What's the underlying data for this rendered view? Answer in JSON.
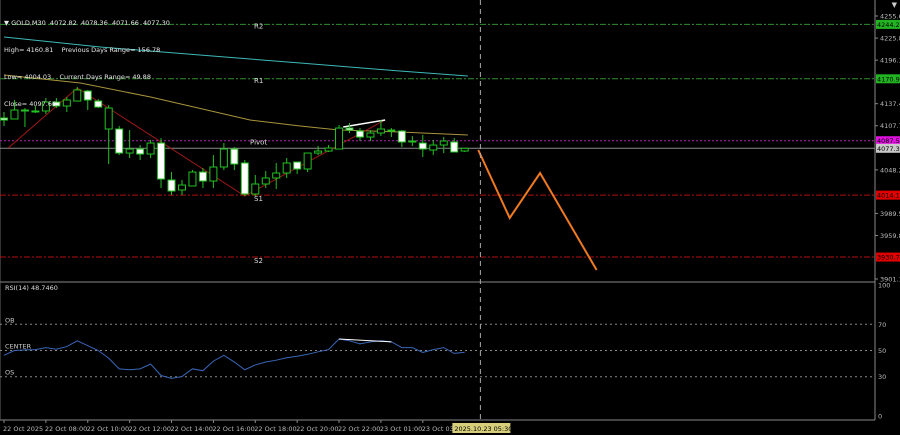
{
  "header": {
    "symbol_line": "GOLD,M30  4072.82  4078.36  4071.66  4077.30",
    "high": "High= 4160.81",
    "prev_range": "Previous Days Range= 156.78",
    "low": "Low= 4004.03",
    "curr_range": "Current Days Range= 49.88",
    "close": "Close= 4097.66"
  },
  "colors": {
    "background": "#000000",
    "candle_outline": "#22c322",
    "bear_fill": "#ffffff",
    "resistance": "#2f8f2f",
    "pivot": "#b020b0",
    "support": "#b01010",
    "ma_slow": "#3fb8b8",
    "ma_fast": "#a8943c",
    "zigzag": "#a01818",
    "forecast": "#f07a20",
    "rsi": "#3a66b8",
    "crosshair_label": "#d8cf7a"
  },
  "chart_data": [
    {
      "type": "candlestick",
      "title": "GOLD,M30",
      "ylim": [
        3901.15,
        4255.6
      ],
      "price_ticks": [
        "4255.60",
        "4225.85",
        "4196.10",
        "4137.45",
        "4107.70",
        "4048.20",
        "3989.55",
        "3959.80",
        "3901.15"
      ],
      "x_tick_labels": [
        "22 Oct 2025",
        "22 Oct 08:00",
        "22 Oct 10:00",
        "22 Oct 12:00",
        "22 Oct 14:00",
        "22 Oct 16:00",
        "22 Oct 18:00",
        "22 Oct 20:00",
        "22 Oct 22:00",
        "23 Oct 01:00",
        "23 Oct 03"
      ],
      "x_tick_bars": [
        0,
        4,
        8,
        12,
        16,
        20,
        24,
        28,
        32,
        36,
        40
      ],
      "candles_ohlc": [
        [
          4118.1,
          4126.2,
          4107.3,
          4115.4
        ],
        [
          4116.8,
          4142.4,
          4116.8,
          4128.9
        ],
        [
          4128.9,
          4131.6,
          4106.0,
          4128.0
        ],
        [
          4127.6,
          4134.3,
          4124.9,
          4127.0
        ],
        [
          4127.6,
          4145.1,
          4123.5,
          4139.7
        ],
        [
          4139.7,
          4145.1,
          4131.6,
          4134.3
        ],
        [
          4134.3,
          4146.4,
          4126.2,
          4142.4
        ],
        [
          4141.0,
          4159.9,
          4141.0,
          4155.9
        ],
        [
          4154.5,
          4155.9,
          4128.9,
          4142.4
        ],
        [
          4141.0,
          4143.7,
          4131.6,
          4132.9
        ],
        [
          4103.3,
          4135.6,
          4056.1,
          4131.6
        ],
        [
          4103.3,
          4107.3,
          4068.2,
          4070.9
        ],
        [
          4070.9,
          4101.9,
          4064.2,
          4076.3
        ],
        [
          4076.3,
          4081.7,
          4061.5,
          4069.6
        ],
        [
          4069.6,
          4088.5,
          4064.2,
          4084.4
        ],
        [
          4084.4,
          4091.2,
          4023.8,
          4035.9
        ],
        [
          4034.6,
          4045.3,
          4014.3,
          4019.7
        ],
        [
          4021.1,
          4034.6,
          4014.3,
          4027.8
        ],
        [
          4026.5,
          4048.0,
          4026.5,
          4045.3
        ],
        [
          4045.3,
          4050.7,
          4023.8,
          4033.2
        ],
        [
          4033.2,
          4068.2,
          4023.8,
          4052.1
        ],
        [
          4052.1,
          4084.4,
          4048.0,
          4076.3
        ],
        [
          4076.3,
          4079.0,
          4048.0,
          4056.1
        ],
        [
          4057.5,
          4061.5,
          4013.0,
          4015.7
        ],
        [
          4015.7,
          4041.3,
          4013.0,
          4029.2
        ],
        [
          4029.2,
          4046.7,
          4023.8,
          4037.3
        ],
        [
          4037.3,
          4057.5,
          4022.4,
          4044.0
        ],
        [
          4044.0,
          4064.2,
          4037.3,
          4057.5
        ],
        [
          4058.8,
          4058.8,
          4042.6,
          4049.4
        ],
        [
          4049.4,
          4070.9,
          4045.3,
          4070.9
        ],
        [
          4070.9,
          4080.4,
          4068.2,
          4073.6
        ],
        [
          4073.6,
          4081.7,
          4072.3,
          4077.7
        ],
        [
          4076.3,
          4108.7,
          4076.3,
          4104.6
        ],
        [
          4104.6,
          4111.4,
          4097.9,
          4101.9
        ],
        [
          4100.6,
          4104.6,
          4087.1,
          4092.5
        ],
        [
          4092.5,
          4101.9,
          4087.1,
          4097.9
        ],
        [
          4097.9,
          4115.4,
          4093.9,
          4103.3
        ],
        [
          4101.9,
          4104.6,
          4092.5,
          4101.0
        ],
        [
          4100.6,
          4101.9,
          4079.0,
          4085.8
        ],
        [
          4087.1,
          4093.9,
          4080.4,
          4086.5
        ],
        [
          4084.4,
          4095.2,
          4065.6,
          4076.3
        ],
        [
          4075.0,
          4088.5,
          4068.2,
          4081.7
        ],
        [
          4081.7,
          4092.5,
          4070.9,
          4087.1
        ],
        [
          4085.8,
          4091.2,
          4072.3,
          4072.3
        ],
        [
          4073.6,
          4077.7,
          4072.3,
          4077.3
        ]
      ],
      "levels": [
        {
          "name": "R2",
          "price": 4244.28,
          "label": "4244.28",
          "kind": "resistance"
        },
        {
          "name": "R1",
          "price": 4170.97,
          "label": "4170.97",
          "kind": "resistance"
        },
        {
          "name": "Pivot",
          "price": 4087.5,
          "label": "4087.50",
          "kind": "pivot"
        },
        {
          "name": "S1",
          "price": 4014.19,
          "label": "4014.19",
          "kind": "support"
        },
        {
          "name": "S2",
          "price": 3930.72,
          "label": "3930.72",
          "kind": "support"
        }
      ],
      "current_price": {
        "price": 4077.3,
        "label": "4077.30"
      },
      "ma_slow": [
        [
          0,
          4227.3
        ],
        [
          9.2,
          4213.8
        ],
        [
          18.7,
          4203.0
        ],
        [
          28.3,
          4192.2
        ],
        [
          37.8,
          4181.5
        ],
        [
          44.3,
          4174.7
        ]
      ],
      "ma_fast": [
        [
          0,
          4176.1
        ],
        [
          7.3,
          4165.3
        ],
        [
          14,
          4146.4
        ],
        [
          23.5,
          4115.4
        ],
        [
          28.3,
          4107.3
        ],
        [
          32,
          4101.9
        ],
        [
          37.8,
          4099.3
        ],
        [
          44.3,
          4095.2
        ]
      ],
      "zigzag": [
        [
          0.4,
          4077.7
        ],
        [
          7,
          4158.6
        ],
        [
          23,
          4013.0
        ],
        [
          36.4,
          4115.4
        ]
      ],
      "trendline": [
        [
          32.4,
          4106.0
        ],
        [
          36.4,
          4115.4
        ]
      ],
      "forecast_path": [
        [
          45.3,
          4075.0
        ],
        [
          48.3,
          3983.4
        ],
        [
          51.2,
          4044.0
        ],
        [
          56.6,
          3913.3
        ]
      ],
      "crosshair": {
        "bar": 45.5,
        "label": "2025.10.23 05:30"
      }
    },
    {
      "type": "line",
      "title": "RSI(14) 48.7460",
      "ylim": [
        0,
        100
      ],
      "y_ticks": [
        "100",
        "70",
        "50",
        "30",
        "0"
      ],
      "levels": [
        {
          "name": "OB",
          "value": 70
        },
        {
          "name": "CENTER",
          "value": 50
        },
        {
          "name": "OS",
          "value": 30
        }
      ],
      "values": [
        46.3,
        50,
        50.5,
        50.7,
        52.2,
        51,
        53,
        57.4,
        53.7,
        50,
        44.1,
        36,
        35.3,
        36,
        39.7,
        30.9,
        28.7,
        30.1,
        36,
        34.6,
        41.9,
        46.3,
        41.2,
        35.3,
        39,
        41.2,
        42.6,
        44.5,
        45.6,
        47.1,
        49,
        50.7,
        58.8,
        57.4,
        55.1,
        56.6,
        57.4,
        56.6,
        52.2,
        52.2,
        48.5,
        50.7,
        52.2,
        47.8,
        48.7
      ],
      "divergence_line": [
        [
          32,
          58.8
        ],
        [
          37,
          56.6
        ]
      ]
    }
  ]
}
